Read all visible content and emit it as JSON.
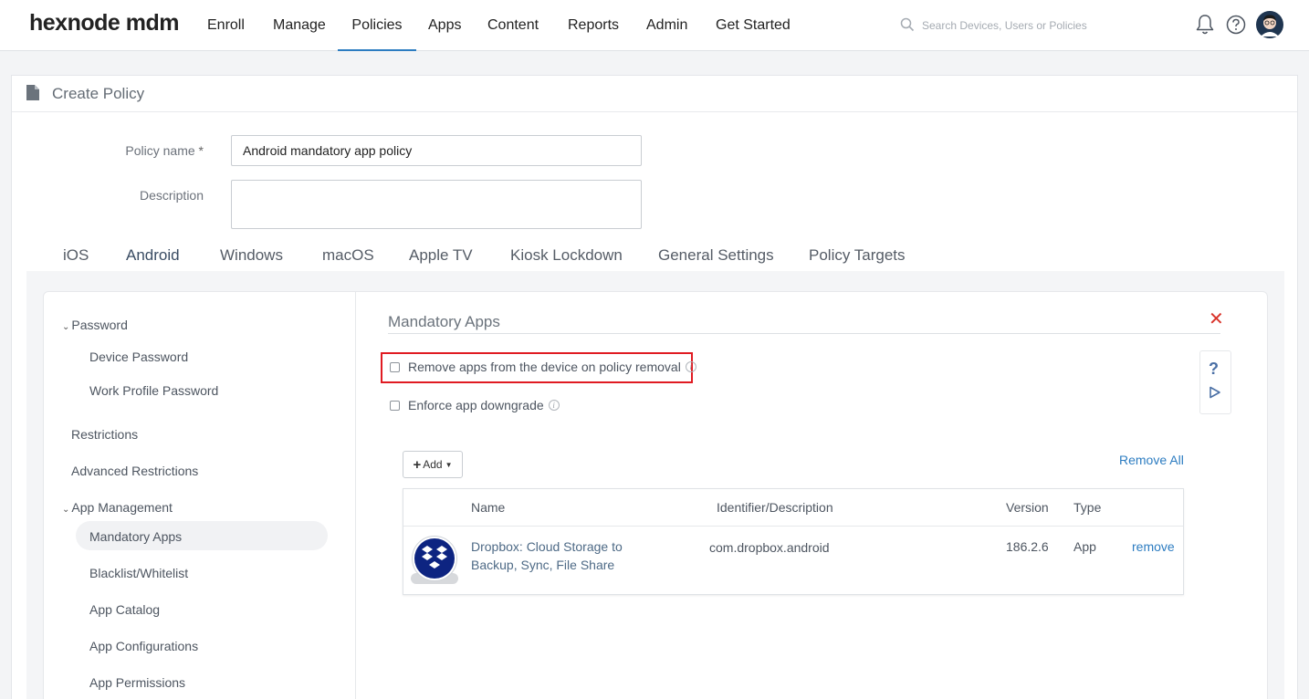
{
  "app": {
    "logo": "hexnode mdm"
  },
  "nav": {
    "items": [
      "Enroll",
      "Manage",
      "Policies",
      "Apps",
      "Content",
      "Reports",
      "Admin",
      "Get Started"
    ],
    "active": "Policies"
  },
  "search": {
    "placeholder": "Search Devices, Users or Policies"
  },
  "page": {
    "title": "Create Policy"
  },
  "form": {
    "policy_name_label": "Policy name",
    "required_mark": "*",
    "policy_name_value": "Android mandatory app policy",
    "description_label": "Description",
    "description_value": ""
  },
  "os_tabs": {
    "items": [
      "iOS",
      "Android",
      "Windows",
      "macOS",
      "Apple TV",
      "Kiosk Lockdown",
      "General Settings",
      "Policy Targets"
    ],
    "active": "Android"
  },
  "sidebar": {
    "password_group": "Password",
    "device_password": "Device Password",
    "work_profile_password": "Work Profile Password",
    "restrictions": "Restrictions",
    "advanced_restrictions": "Advanced Restrictions",
    "app_management_group": "App Management",
    "mandatory_apps": "Mandatory Apps",
    "blacklist_whitelist": "Blacklist/Whitelist",
    "app_catalog": "App Catalog",
    "app_configurations": "App Configurations",
    "app_permissions": "App Permissions",
    "active": "Mandatory Apps"
  },
  "content": {
    "title": "Mandatory Apps",
    "remove_apps_label": "Remove apps from the device on policy removal",
    "remove_apps_checked": false,
    "enforce_downgrade_label": "Enforce app downgrade",
    "enforce_downgrade_checked": false,
    "add_label": "Add",
    "remove_all_label": "Remove All"
  },
  "table": {
    "headers": {
      "name": "Name",
      "identifier": "Identifier/Description",
      "version": "Version",
      "type": "Type"
    },
    "rows": [
      {
        "name": "Dropbox: Cloud Storage to Backup, Sync, File Share",
        "identifier": "com.dropbox.android",
        "version": "186.2.6",
        "type": "App",
        "action": "remove",
        "icon": "dropbox-icon"
      }
    ]
  },
  "colors": {
    "accent": "#2c7cc1",
    "highlight": "#e01b22",
    "close": "#d9342b",
    "dropbox_blue": "#0d2481"
  },
  "icons": {
    "search": "search-icon",
    "bell": "bell-icon",
    "help": "help-circle-icon",
    "avatar": "avatar",
    "page": "document-icon",
    "close": "close-icon",
    "info": "info-icon"
  }
}
